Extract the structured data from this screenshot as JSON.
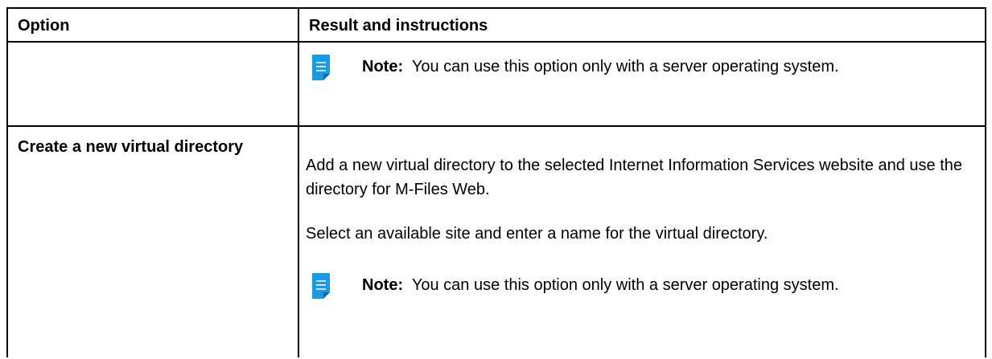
{
  "table": {
    "headers": {
      "option": "Option",
      "result": "Result and instructions"
    },
    "rows": [
      {
        "option": "",
        "note": {
          "label": "Note:",
          "text": "You can use this option only with a server operating system."
        }
      },
      {
        "option": "Create a new virtual directory",
        "paragraphs": [
          "Add a new virtual directory to the selected Internet Information Services website and use the directory for M-Files Web.",
          "Select an available site and enter a name for the virtual directory."
        ],
        "note": {
          "label": "Note:",
          "text": "You can use this option only with a server operating system."
        }
      }
    ]
  },
  "icons": {
    "note": "note-icon"
  },
  "colors": {
    "note_icon": "#1a9ae0",
    "note_icon_fold": "#0d6fb0",
    "border": "#000000"
  }
}
